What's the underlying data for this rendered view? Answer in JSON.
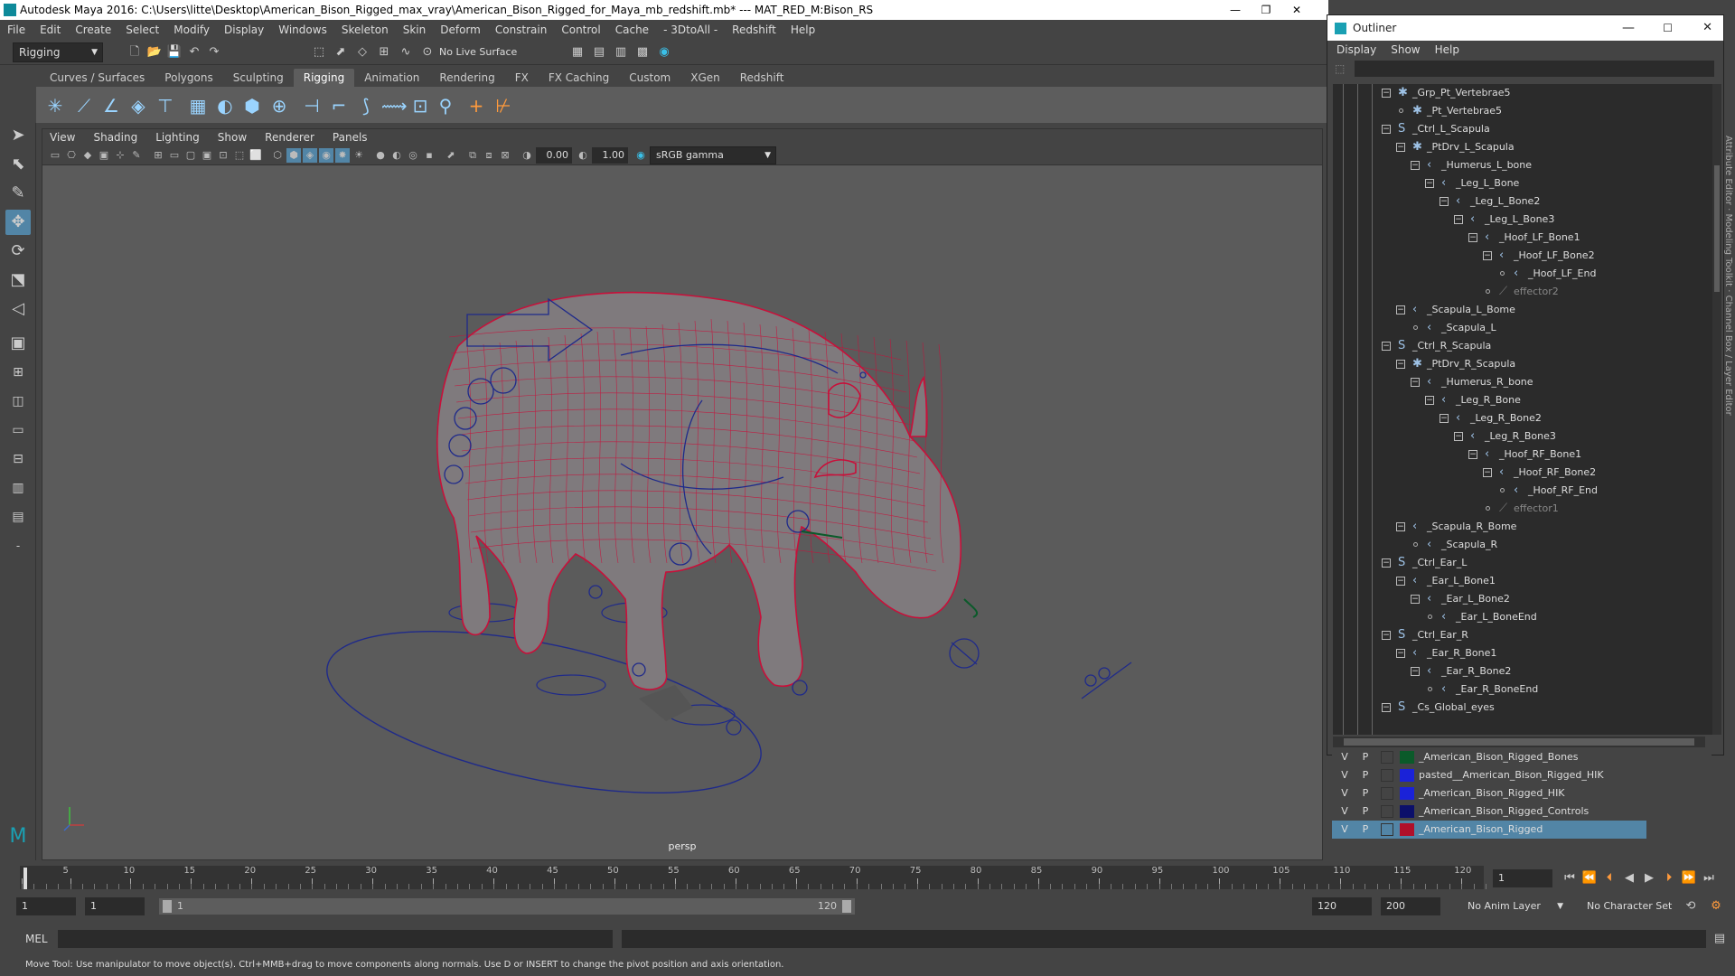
{
  "window": {
    "title": "Autodesk Maya 2016: C:\\Users\\litte\\Desktop\\American_Bison_Rigged_max_vray\\American_Bison_Rigged_for_Maya_mb_redshift.mb*   ---   MAT_RED_M:Bison_RS"
  },
  "menu": [
    "File",
    "Edit",
    "Create",
    "Select",
    "Modify",
    "Display",
    "Windows",
    "Skeleton",
    "Skin",
    "Deform",
    "Constrain",
    "Control",
    "Cache",
    "- 3DtoAll -",
    "Redshift",
    "Help"
  ],
  "statusline": {
    "mode": "Rigging",
    "live_surface": "No Live Surface"
  },
  "shelf_tabs": [
    "Curves / Surfaces",
    "Polygons",
    "Sculpting",
    "Rigging",
    "Animation",
    "Rendering",
    "FX",
    "FX Caching",
    "Custom",
    "XGen",
    "Redshift"
  ],
  "viewport": {
    "menu": [
      "View",
      "Shading",
      "Lighting",
      "Show",
      "Renderer",
      "Panels"
    ],
    "exposure": "0.00",
    "gamma": "1.00",
    "color_space": "sRGB gamma",
    "camera_label": "persp"
  },
  "outliner": {
    "title": "Outliner",
    "menu": [
      "Display",
      "Show",
      "Help"
    ],
    "rows": [
      {
        "label": "_Grp_Pt_Vertebrae5",
        "icon": "locator",
        "depth": 4,
        "exp": true
      },
      {
        "label": "_Pt_Vertebrae5",
        "icon": "locator",
        "depth": 5,
        "exp": false
      },
      {
        "label": "_Ctrl_L_Scapula",
        "icon": "curve",
        "depth": 4,
        "exp": true
      },
      {
        "label": "_PtDrv_L_Scapula",
        "icon": "locator",
        "depth": 5,
        "exp": true
      },
      {
        "label": "_Humerus_L_bone",
        "icon": "joint",
        "depth": 6,
        "exp": true
      },
      {
        "label": "_Leg_L_Bone",
        "icon": "joint",
        "depth": 7,
        "exp": true
      },
      {
        "label": "_Leg_L_Bone2",
        "icon": "joint",
        "depth": 8,
        "exp": true
      },
      {
        "label": "_Leg_L_Bone3",
        "icon": "joint",
        "depth": 9,
        "exp": true
      },
      {
        "label": "_Hoof_LF_Bone1",
        "icon": "joint",
        "depth": 10,
        "exp": true
      },
      {
        "label": "_Hoof_LF_Bone2",
        "icon": "joint",
        "depth": 11,
        "exp": true
      },
      {
        "label": "_Hoof_LF_End",
        "icon": "joint",
        "depth": 12,
        "exp": false
      },
      {
        "label": "effector2",
        "icon": "effector",
        "depth": 11,
        "exp": false,
        "dim": true
      },
      {
        "label": "_Scapula_L_Bome",
        "icon": "joint",
        "depth": 5,
        "exp": true
      },
      {
        "label": "_Scapula_L",
        "icon": "joint",
        "depth": 6,
        "exp": false
      },
      {
        "label": "_Ctrl_R_Scapula",
        "icon": "curve",
        "depth": 4,
        "exp": true
      },
      {
        "label": "_PtDrv_R_Scapula",
        "icon": "locator",
        "depth": 5,
        "exp": true
      },
      {
        "label": "_Humerus_R_bone",
        "icon": "joint",
        "depth": 6,
        "exp": true
      },
      {
        "label": "_Leg_R_Bone",
        "icon": "joint",
        "depth": 7,
        "exp": true
      },
      {
        "label": "_Leg_R_Bone2",
        "icon": "joint",
        "depth": 8,
        "exp": true
      },
      {
        "label": "_Leg_R_Bone3",
        "icon": "joint",
        "depth": 9,
        "exp": true
      },
      {
        "label": "_Hoof_RF_Bone1",
        "icon": "joint",
        "depth": 10,
        "exp": true
      },
      {
        "label": "_Hoof_RF_Bone2",
        "icon": "joint",
        "depth": 11,
        "exp": true
      },
      {
        "label": "_Hoof_RF_End",
        "icon": "joint",
        "depth": 12,
        "exp": false
      },
      {
        "label": "effector1",
        "icon": "effector",
        "depth": 11,
        "exp": false,
        "dim": true
      },
      {
        "label": "_Scapula_R_Bome",
        "icon": "joint",
        "depth": 5,
        "exp": true
      },
      {
        "label": "_Scapula_R",
        "icon": "joint",
        "depth": 6,
        "exp": false
      },
      {
        "label": "_Ctrl_Ear_L",
        "icon": "curve",
        "depth": 4,
        "exp": true
      },
      {
        "label": "_Ear_L_Bone1",
        "icon": "joint",
        "depth": 5,
        "exp": true
      },
      {
        "label": "_Ear_L_Bone2",
        "icon": "joint",
        "depth": 6,
        "exp": true
      },
      {
        "label": "_Ear_L_BoneEnd",
        "icon": "joint",
        "depth": 7,
        "exp": false
      },
      {
        "label": "_Ctrl_Ear_R",
        "icon": "curve",
        "depth": 4,
        "exp": true
      },
      {
        "label": "_Ear_R_Bone1",
        "icon": "joint",
        "depth": 5,
        "exp": true
      },
      {
        "label": "_Ear_R_Bone2",
        "icon": "joint",
        "depth": 6,
        "exp": true
      },
      {
        "label": "_Ear_R_BoneEnd",
        "icon": "joint",
        "depth": 7,
        "exp": false
      },
      {
        "label": "_Cs_Global_eyes",
        "icon": "curve",
        "depth": 4,
        "exp": true
      }
    ]
  },
  "layers": [
    {
      "v": "V",
      "p": "P",
      "color": "#0b5a2a",
      "name": "_American_Bison_Rigged_Bones",
      "selected": false
    },
    {
      "v": "V",
      "p": "P",
      "color": "#1a22d8",
      "name": "pasted__American_Bison_Rigged_HIK",
      "selected": false
    },
    {
      "v": "V",
      "p": "P",
      "color": "#1a22d8",
      "name": "_American_Bison_Rigged_HIK",
      "selected": false
    },
    {
      "v": "V",
      "p": "P",
      "color": "#0b0f6a",
      "name": "_American_Bison_Rigged_Controls",
      "selected": false
    },
    {
      "v": "V",
      "p": "P",
      "color": "#b0102a",
      "name": "_American_Bison_Rigged",
      "selected": true
    }
  ],
  "timeline": {
    "ticks": [
      1,
      5,
      10,
      15,
      20,
      25,
      30,
      35,
      40,
      45,
      50,
      55,
      60,
      65,
      70,
      75,
      80,
      85,
      90,
      95,
      100,
      105,
      110,
      115,
      120
    ],
    "current_frame": "1",
    "range_start": "1",
    "range_start2": "1",
    "range_inner_start": "1",
    "range_inner_end": "120",
    "range_end": "120",
    "anim_end": "200",
    "anim_layer": "No Anim Layer",
    "char_set": "No Character Set"
  },
  "command": {
    "lang": "MEL"
  },
  "help_line": "Move Tool: Use manipulator to move object(s). Ctrl+MMB+drag to move components along normals. Use D or INSERT to change the pivot position and axis orientation.",
  "colors": {
    "mesh_wire": "#c8103a",
    "controls": "#1f2a8a",
    "accent": "#5285a6"
  }
}
